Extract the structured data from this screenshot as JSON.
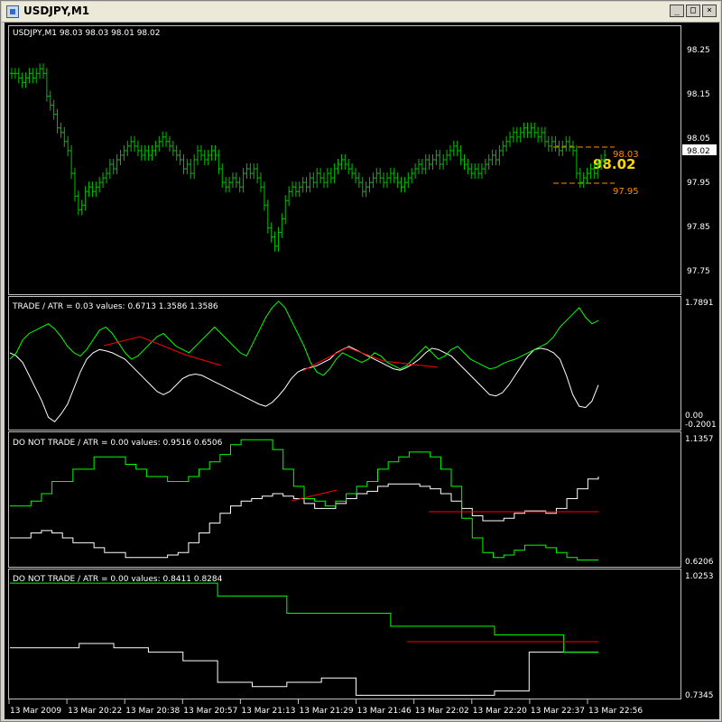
{
  "window": {
    "title": "USDJPY,M1",
    "buttons": [
      "_",
      "□",
      "×"
    ]
  },
  "colors": {
    "background": "#000000",
    "grid": "#c0c0c0",
    "bars": "#00c000",
    "green_line": "#00ff00",
    "white_line": "#ffffff",
    "red_line": "#ff0000",
    "dashed_level": "#ff8c00",
    "big_price": "#ffd700"
  },
  "main_chart": {
    "header": "USDJPY,M1  98.03 98.03 98.01 98.02",
    "price_axis": [
      "98.25",
      "98.15",
      "98.05",
      "98.02",
      "97.95",
      "97.85",
      "97.75"
    ],
    "current_price": "98.02",
    "big_price": "98.02",
    "level_upper": "98.03",
    "level_lower": "97.95"
  },
  "panel1": {
    "header": "TRADE  /  ATR = 0.03     values: 0.6713  1.3586  1.3586",
    "axis_top": "1.7891",
    "axis_mid": "0.00",
    "axis_bottom": "-0.2001"
  },
  "panel2": {
    "header": "DO NOT TRADE  /  ATR = 0.00     values: 0.9516  0.6506",
    "axis_top": "1.1357",
    "axis_bottom": "0.6206"
  },
  "panel3": {
    "header": "DO NOT TRADE  /  ATR = 0.00     values: 0.8411  0.8284",
    "axis_top": "1.0253",
    "axis_bottom": "0.7345"
  },
  "time_axis": [
    "13 Mar 2009",
    "13 Mar 20:22",
    "13 Mar 20:38",
    "13 Mar 20:57",
    "13 Mar 21:13",
    "13 Mar 21:29",
    "13 Mar 21:46",
    "13 Mar 22:02",
    "13 Mar 22:20",
    "13 Mar 22:37",
    "13 Mar 22:56"
  ],
  "chart_data": {
    "type": "bar",
    "main_close": [
      98.2,
      98.2,
      98.19,
      98.18,
      98.19,
      98.2,
      98.19,
      98.2,
      98.21,
      98.2,
      98.15,
      98.13,
      98.11,
      98.08,
      98.07,
      98.05,
      98.03,
      97.98,
      97.93,
      97.9,
      97.91,
      97.94,
      97.95,
      97.94,
      97.95,
      97.96,
      97.97,
      97.98,
      98.0,
      97.99,
      98.01,
      98.02,
      98.03,
      98.04,
      98.05,
      98.04,
      98.03,
      98.02,
      98.03,
      98.02,
      98.03,
      98.04,
      98.05,
      98.06,
      98.05,
      98.04,
      98.03,
      98.02,
      98.01,
      97.99,
      98.0,
      97.98,
      98.01,
      98.03,
      98.02,
      98.01,
      98.02,
      98.03,
      98.02,
      97.99,
      97.96,
      97.95,
      97.96,
      97.97,
      97.96,
      97.95,
      97.98,
      97.99,
      97.98,
      97.99,
      97.97,
      97.95,
      97.91,
      97.86,
      97.84,
      97.82,
      97.85,
      97.88,
      97.92,
      97.94,
      97.95,
      97.94,
      97.95,
      97.96,
      97.95,
      97.97,
      97.96,
      97.98,
      97.97,
      97.96,
      97.98,
      97.97,
      97.99,
      98.0,
      98.01,
      98.0,
      97.99,
      97.98,
      97.97,
      97.96,
      97.94,
      97.95,
      97.96,
      97.97,
      97.98,
      97.97,
      97.96,
      97.97,
      97.98,
      97.97,
      97.96,
      97.95,
      97.96,
      97.97,
      97.98,
      97.99,
      98.0,
      97.99,
      98.01,
      98.0,
      98.01,
      98.02,
      98.0,
      98.01,
      98.02,
      98.03,
      98.04,
      98.03,
      98.01,
      98.0,
      97.99,
      97.98,
      97.99,
      97.98,
      97.99,
      98.0,
      98.01,
      98.02,
      98.01,
      98.03,
      98.04,
      98.05,
      98.06,
      98.07,
      98.06,
      98.07,
      98.08,
      98.07,
      98.08,
      98.07,
      98.06,
      98.07,
      98.05,
      98.04,
      98.05,
      98.04,
      98.03,
      98.04,
      98.05,
      98.04,
      98.03,
      97.98,
      97.96,
      97.97,
      97.98,
      97.99,
      97.98,
      98.0,
      98.01,
      98.02
    ],
    "price_range": [
      97.72,
      98.3
    ],
    "trade_green": [
      0.85,
      0.95,
      1.15,
      1.25,
      1.3,
      1.35,
      1.4,
      1.32,
      1.2,
      1.05,
      0.95,
      0.9,
      1.0,
      1.15,
      1.3,
      1.35,
      1.25,
      1.1,
      0.95,
      0.85,
      0.9,
      1.0,
      1.1,
      1.2,
      1.25,
      1.15,
      1.05,
      1.0,
      0.95,
      1.05,
      1.15,
      1.25,
      1.35,
      1.25,
      1.15,
      1.05,
      0.95,
      0.9,
      1.1,
      1.3,
      1.5,
      1.65,
      1.75,
      1.65,
      1.45,
      1.25,
      1.05,
      0.8,
      0.65,
      0.6,
      0.7,
      0.85,
      0.95,
      0.9,
      0.85,
      0.8,
      0.85,
      0.95,
      0.9,
      0.8,
      0.75,
      0.7,
      0.75,
      0.85,
      0.95,
      1.05,
      0.95,
      0.85,
      0.9,
      1.0,
      1.05,
      0.95,
      0.85,
      0.8,
      0.75,
      0.7,
      0.72,
      0.78,
      0.82,
      0.85,
      0.9,
      0.95,
      1.0,
      1.05,
      1.1,
      1.2,
      1.35,
      1.45,
      1.55,
      1.65,
      1.5,
      1.4,
      1.45
    ],
    "trade_white": [
      0.95,
      0.9,
      0.8,
      0.6,
      0.4,
      0.2,
      -0.05,
      -0.12,
      0.0,
      0.15,
      0.4,
      0.65,
      0.85,
      0.95,
      1.0,
      0.98,
      0.95,
      0.9,
      0.85,
      0.75,
      0.65,
      0.55,
      0.45,
      0.35,
      0.3,
      0.35,
      0.45,
      0.55,
      0.6,
      0.62,
      0.6,
      0.55,
      0.5,
      0.45,
      0.4,
      0.35,
      0.3,
      0.25,
      0.2,
      0.15,
      0.12,
      0.18,
      0.28,
      0.4,
      0.55,
      0.65,
      0.7,
      0.72,
      0.75,
      0.8,
      0.85,
      0.95,
      1.0,
      1.05,
      1.0,
      0.95,
      0.9,
      0.85,
      0.8,
      0.75,
      0.7,
      0.68,
      0.72,
      0.78,
      0.85,
      0.95,
      1.02,
      1.0,
      0.95,
      0.9,
      0.8,
      0.7,
      0.6,
      0.5,
      0.4,
      0.3,
      0.28,
      0.33,
      0.45,
      0.6,
      0.75,
      0.9,
      1.0,
      1.02,
      1.0,
      0.95,
      0.85,
      0.6,
      0.3,
      0.12,
      0.1,
      0.2,
      0.45
    ],
    "do_not_trade_1_green": [
      0.85,
      0.85,
      0.87,
      0.9,
      0.95,
      0.95,
      1.0,
      1.0,
      1.05,
      1.05,
      1.05,
      1.02,
      1.0,
      0.97,
      0.97,
      0.95,
      0.95,
      0.97,
      1.0,
      1.03,
      1.06,
      1.1,
      1.12,
      1.12,
      1.12,
      1.08,
      1.0,
      0.93,
      0.88,
      0.87,
      0.85,
      0.87,
      0.9,
      0.93,
      0.95,
      1.0,
      1.03,
      1.05,
      1.07,
      1.07,
      1.05,
      1.0,
      0.93,
      0.8,
      0.72,
      0.66,
      0.64,
      0.65,
      0.67,
      0.69,
      0.69,
      0.68,
      0.66,
      0.64,
      0.63,
      0.63,
      0.63
    ],
    "do_not_trade_1_white": [
      0.72,
      0.72,
      0.74,
      0.75,
      0.74,
      0.72,
      0.7,
      0.7,
      0.68,
      0.66,
      0.66,
      0.64,
      0.64,
      0.64,
      0.64,
      0.65,
      0.66,
      0.7,
      0.74,
      0.78,
      0.82,
      0.85,
      0.87,
      0.88,
      0.89,
      0.9,
      0.89,
      0.88,
      0.86,
      0.84,
      0.84,
      0.86,
      0.88,
      0.9,
      0.91,
      0.93,
      0.94,
      0.94,
      0.94,
      0.93,
      0.92,
      0.9,
      0.87,
      0.84,
      0.81,
      0.79,
      0.79,
      0.8,
      0.82,
      0.83,
      0.83,
      0.82,
      0.84,
      0.88,
      0.92,
      0.96,
      0.97
    ],
    "do_not_trade_2_green": [
      1.0,
      1.0,
      1.0,
      1.0,
      1.0,
      1.0,
      0.97,
      0.97,
      0.93,
      0.93,
      0.93,
      0.9,
      0.9,
      0.9,
      0.88,
      0.88,
      0.84,
      0.84
    ],
    "do_not_trade_2_white": [
      0.85,
      0.85,
      0.86,
      0.85,
      0.84,
      0.82,
      0.77,
      0.76,
      0.77,
      0.78,
      0.74,
      0.74,
      0.74,
      0.74,
      0.75,
      0.84,
      0.84,
      0.84
    ]
  }
}
